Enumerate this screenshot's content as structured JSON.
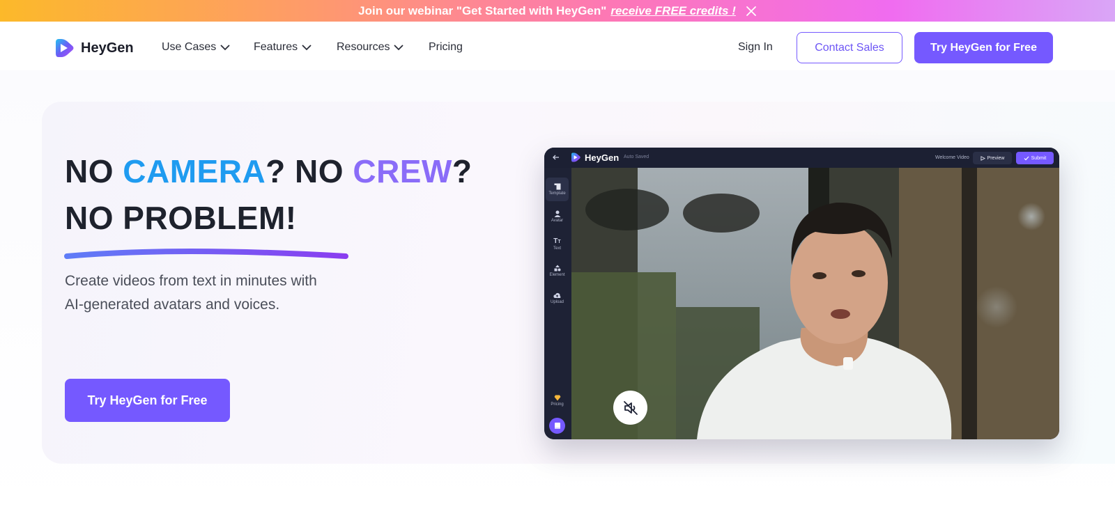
{
  "banner": {
    "text": "Join our webinar \"Get Started with HeyGen\"",
    "link": "receive FREE credits !",
    "close_icon": "close-icon"
  },
  "nav": {
    "logo_text": "HeyGen",
    "items": [
      {
        "label": "Use Cases",
        "has_dropdown": true
      },
      {
        "label": "Features",
        "has_dropdown": true
      },
      {
        "label": "Resources",
        "has_dropdown": true
      },
      {
        "label": "Pricing",
        "has_dropdown": false
      }
    ],
    "sign_in": "Sign In",
    "contact_sales": "Contact Sales",
    "try_free": "Try HeyGen for Free"
  },
  "hero": {
    "line1_a": "NO ",
    "line1_b": "CAMERA",
    "line1_c": "? NO ",
    "line1_d": "CREW",
    "line1_e": "?",
    "line2": "NO PROBLEM!",
    "sub_line1": "Create videos from text in minutes with",
    "sub_line2": "AI-generated avatars and voices.",
    "cta": "Try HeyGen for Free"
  },
  "app": {
    "logo_text": "HeyGen",
    "auto_saved": "Auto Saved",
    "video_title": "Welcome Video",
    "preview": "Preview",
    "submit": "Submit",
    "sidebar": [
      {
        "label": "Template",
        "icon": "template-icon"
      },
      {
        "label": "Avatar",
        "icon": "avatar-icon"
      },
      {
        "label": "Text",
        "icon": "text-icon"
      },
      {
        "label": "Element",
        "icon": "element-icon"
      },
      {
        "label": "Upload",
        "icon": "upload-icon"
      }
    ],
    "pricing": "Pricing"
  },
  "colors": {
    "accent": "#7559ff",
    "blue": "#1f9bf0",
    "purple": "#8a6cf8"
  }
}
